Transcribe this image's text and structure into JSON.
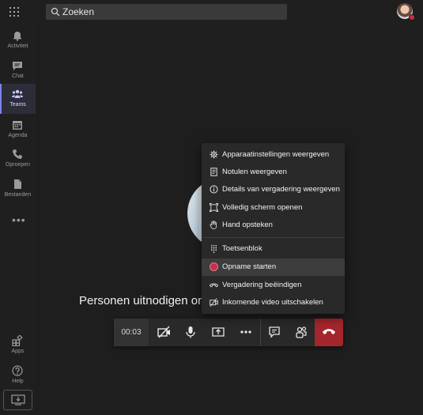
{
  "search": {
    "placeholder": "Zoeken"
  },
  "rail": {
    "items": [
      {
        "label": "Activiteit",
        "icon": "bell-icon"
      },
      {
        "label": "Chat",
        "icon": "chat-icon"
      },
      {
        "label": "Teams",
        "icon": "teams-icon",
        "active": true
      },
      {
        "label": "Agenda",
        "icon": "calendar-icon"
      },
      {
        "label": "Oproepen",
        "icon": "phone-icon"
      },
      {
        "label": "Bestanden",
        "icon": "file-icon"
      }
    ],
    "more": "•••",
    "bottom_items": [
      {
        "label": "Apps",
        "icon": "apps-icon"
      },
      {
        "label": "Help",
        "icon": "help-icon"
      }
    ]
  },
  "stage": {
    "invite_text": "Personen uitnodigen om deel te nemen"
  },
  "callbar": {
    "timer": "00:03",
    "buttons": [
      "camera-off-icon",
      "microphone-icon",
      "share-screen-icon",
      "more-icon",
      "chat-icon",
      "participants-icon"
    ],
    "hangup_color": "#a4262c"
  },
  "menu": {
    "items": [
      {
        "label": "Apparaatinstellingen weergeven",
        "icon": "gear-icon"
      },
      {
        "label": "Notulen weergeven",
        "icon": "notes-icon"
      },
      {
        "label": "Details van vergadering weergeven",
        "icon": "info-icon"
      },
      {
        "label": "Volledig scherm openen",
        "icon": "fullscreen-icon"
      },
      {
        "label": "Hand opsteken",
        "icon": "hand-icon"
      },
      {
        "label": "Toetsenblok",
        "icon": "keypad-icon"
      },
      {
        "label": "Opname starten",
        "icon": "record-icon",
        "highlighted": true
      },
      {
        "label": "Vergadering beëindigen",
        "icon": "end-call-icon"
      },
      {
        "label": "Inkomende video uitschakelen",
        "icon": "video-off-icon"
      }
    ]
  },
  "colors": {
    "accent": "#7b83eb",
    "record": "#c4314b",
    "background": "#1f1f1f"
  }
}
